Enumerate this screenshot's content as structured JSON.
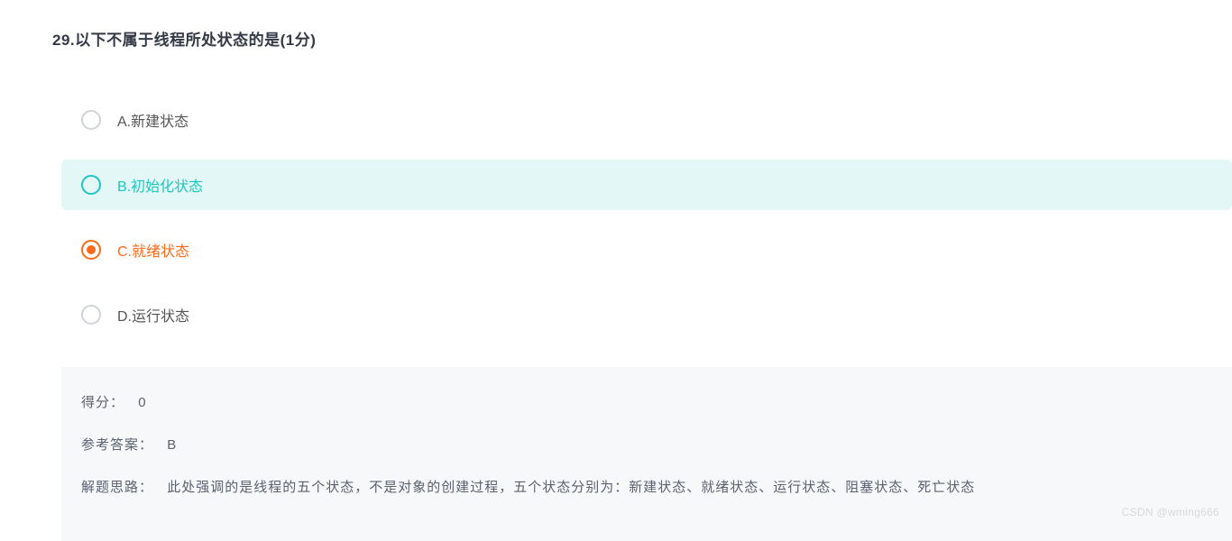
{
  "question": {
    "number_title": "29.以下不属于线程所处状态的是(1分)",
    "options": [
      {
        "label": "A.新建状态",
        "state": "default"
      },
      {
        "label": "B.初始化状态",
        "state": "highlight"
      },
      {
        "label": "C.就绪状态",
        "state": "selected"
      },
      {
        "label": "D.运行状态",
        "state": "default"
      }
    ]
  },
  "answer": {
    "score_label": "得分：",
    "score_value": "0",
    "ref_label": "参考答案：",
    "ref_value": "B",
    "explain_label": "解题思路：",
    "explain_value": "此处强调的是线程的五个状态，不是对象的创建过程，五个状态分别为：新建状态、就绪状态、运行状态、阻塞状态、死亡状态"
  },
  "watermark": "CSDN @wming666"
}
